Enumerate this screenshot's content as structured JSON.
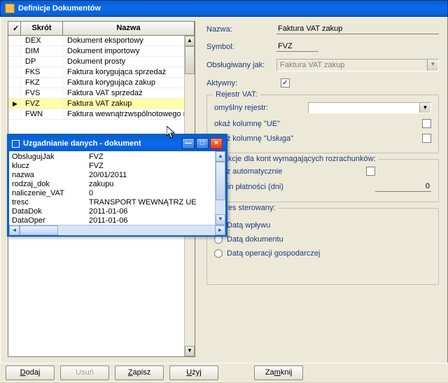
{
  "main_window": {
    "title": "Definicje Dokumentów",
    "grid": {
      "header_mark": "✓",
      "header_skrot": "Skrót",
      "header_nazwa": "Nazwa",
      "rows": [
        {
          "skrot": "DEX",
          "nazwa": "Dokument eksportowy"
        },
        {
          "skrot": "DIM",
          "nazwa": "Dokument importowy"
        },
        {
          "skrot": "DP",
          "nazwa": "Dokument prosty"
        },
        {
          "skrot": "FKS",
          "nazwa": "Faktura korygująca sprzedaż"
        },
        {
          "skrot": "FKZ",
          "nazwa": "Faktura korygująca zakup"
        },
        {
          "skrot": "FVS",
          "nazwa": "Faktura VAT sprzedaż"
        },
        {
          "skrot": "FVZ",
          "nazwa": "Faktura VAT zakup",
          "selected": true,
          "marker": "▶"
        },
        {
          "skrot": "FWN",
          "nazwa": "Faktura wewnątrzwspólnotowego na"
        }
      ]
    },
    "buttons": {
      "dodaj": "Dodaj",
      "usun": "Usuń",
      "zapisz": "Zapisz",
      "uzyj": "Użyj",
      "zamknij": "Zamknij"
    }
  },
  "details": {
    "nazwa_lbl": "Nazwa:",
    "nazwa_val": "Faktura VAT zakup",
    "symbol_lbl": "Symbol:",
    "symbol_val": "FVZ",
    "obslugiwany_lbl": "Obsługiwany jak:",
    "obslugiwany_val": "Faktura VAT zakup",
    "aktywny_lbl": "Aktywny:",
    "aktywny_checked": "✓",
    "vat_group": {
      "title": "Rejestr VAT:",
      "domyslny_lbl": "omyślny rejestr:",
      "kolumna_ue_lbl": "okaż kolumnę \"UE\"",
      "kolumna_usluga_lbl": "okaż kolumnę \"Usługa\""
    },
    "trans_group": {
      "title": "nsakcje dla kont wymagających rozrachunków:",
      "tworz_lbl": "wórz automatycznie",
      "termin_lbl": "ermin płatności (dni)",
      "termin_val": "0"
    },
    "okres_group": {
      "title": "Okres sterowany:",
      "opt1": "Datą wpływu",
      "opt2": "Datą dokumentu",
      "opt3": "Datą operacji gospodarczej"
    }
  },
  "float_window": {
    "title": "Uzgadnianie danych - dokument",
    "rows": [
      {
        "k": "ObslugujJak",
        "v": "FVZ"
      },
      {
        "k": "klucz",
        "v": "FVZ"
      },
      {
        "k": "nazwa",
        "v": "20/01/2011"
      },
      {
        "k": "rodzaj_dok",
        "v": "zakupu"
      },
      {
        "k": "naliczenie_VAT",
        "v": "0"
      },
      {
        "k": "tresc",
        "v": "TRANSPORT WEWNĄTRZ UE"
      },
      {
        "k": "DataDok",
        "v": "2011-01-06"
      },
      {
        "k": "DataOper",
        "v": "2011-01-06"
      }
    ]
  }
}
